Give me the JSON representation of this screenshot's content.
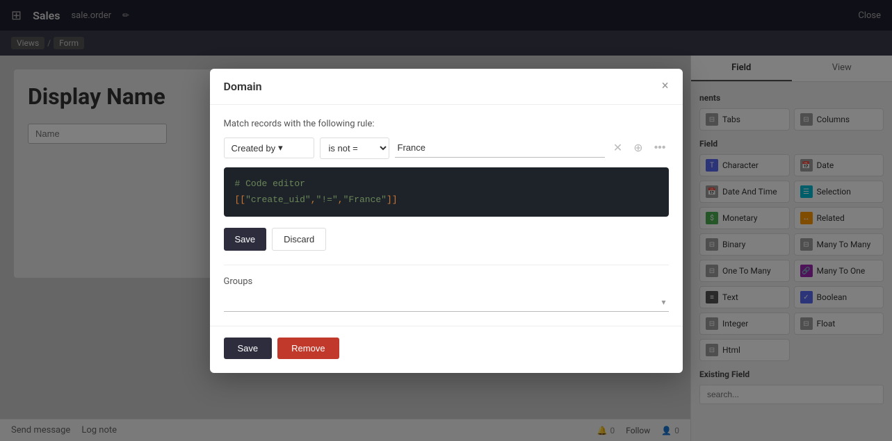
{
  "topbar": {
    "app_icon": "⊞",
    "title": "Sales",
    "model": "sale.order",
    "edit_icon": "✏",
    "close_label": "Close"
  },
  "breadcrumb": {
    "items": [
      "Views",
      "Form"
    ],
    "separator": "/"
  },
  "form_preview": {
    "display_name": "Display Name",
    "name_placeholder": "Name"
  },
  "message_area": {
    "send_message": "Send message",
    "log_note": "Log note",
    "count1": "0",
    "count2": "0",
    "follow": "Follow"
  },
  "right_panel": {
    "tabs": [
      {
        "label": "Field",
        "icon": "⊞",
        "active": true
      },
      {
        "label": "View",
        "icon": "▣",
        "active": false
      }
    ],
    "sections": [
      {
        "title": "nents",
        "items": [
          {
            "label": "Tabs",
            "icon": "⊟"
          },
          {
            "label": "Columns",
            "icon": "⊟"
          }
        ]
      },
      {
        "title": "Field",
        "items": [
          {
            "label": "Character",
            "icon": "T",
            "color": "blue"
          },
          {
            "label": "Date",
            "icon": "📅",
            "color": "grey"
          },
          {
            "label": "Date And Time",
            "icon": "📅",
            "color": "grey"
          },
          {
            "label": "Selection",
            "icon": "☰",
            "color": "teal"
          },
          {
            "label": "Monetary",
            "icon": "$",
            "color": "green"
          },
          {
            "label": "Related",
            "icon": "↔",
            "color": "orange"
          },
          {
            "label": "Binary",
            "icon": "⊟",
            "color": "grey"
          },
          {
            "label": "Many To Many",
            "icon": "⊟",
            "color": "grey"
          },
          {
            "label": "One To Many",
            "icon": "⊟",
            "color": "grey"
          },
          {
            "label": "Many To One",
            "icon": "🔗",
            "color": "purple"
          },
          {
            "label": "Text",
            "icon": "≡",
            "color": "dark"
          },
          {
            "label": "Boolean",
            "icon": "✓",
            "color": "blue"
          },
          {
            "label": "Integer",
            "icon": "⊟",
            "color": "grey"
          },
          {
            "label": "Float",
            "icon": "⊟",
            "color": "grey"
          },
          {
            "label": "Html",
            "icon": "⊟",
            "color": "grey"
          }
        ]
      }
    ],
    "existing_field": {
      "title": "Existing Field",
      "search_placeholder": "search..."
    }
  },
  "modal": {
    "title": "Domain",
    "close_icon": "×",
    "match_rule_text": "Match records with the following rule:",
    "rule": {
      "field_label": "Created by",
      "field_arrow": "▾",
      "operator": "is not =",
      "value": "France"
    },
    "code_editor": {
      "comment": "# Code editor",
      "code": "[[\"create_uid\",\"!=\",\"France\"]]"
    },
    "actions": {
      "save_label": "Save",
      "discard_label": "Discard"
    },
    "groups": {
      "label": "Groups",
      "placeholder": ""
    },
    "footer": {
      "save_label": "Save",
      "remove_label": "Remove"
    }
  }
}
